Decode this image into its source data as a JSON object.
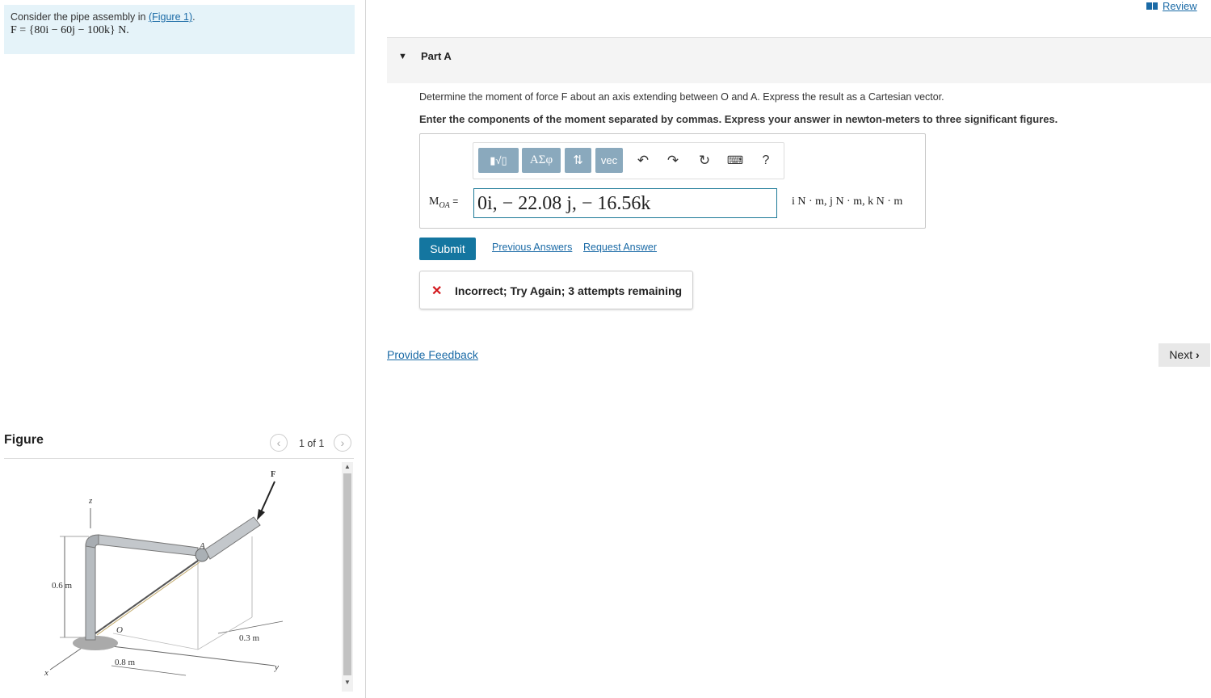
{
  "problem": {
    "intro": "Consider the pipe assembly in ",
    "figure_link": "(Figure 1)",
    "intro_end": ".",
    "force": "F = {80i − 60j − 100k} N."
  },
  "figure": {
    "title": "Figure",
    "page": "1 of 1",
    "labels": {
      "z": "z",
      "x": "x",
      "y": "y",
      "F": "F",
      "A": "A",
      "O": "O",
      "h": "0.6 m",
      "d1": "0.8 m",
      "d2": "0.3 m"
    }
  },
  "header": {
    "review": "Review"
  },
  "part": {
    "title": "Part A",
    "question": "Determine the moment of force F about an axis extending between O and A. Express the result as a Cartesian vector.",
    "instruction": "Enter the components of the moment separated by commas. Express your answer in newton-meters to three significant figures."
  },
  "toolbar": {
    "template": "▮√▯",
    "greek": "ΑΣφ",
    "arrows": "⇅",
    "vec": "vec",
    "help": "?"
  },
  "answer": {
    "label": "M",
    "label_sub": "OA",
    "equals": "=",
    "value": "0i, − 22.08 j, − 16.56k",
    "units": "i N · m, j N · m, k N · m"
  },
  "actions": {
    "submit": "Submit",
    "previous_answers": "Previous Answers",
    "request_answer": "Request Answer"
  },
  "feedback": {
    "icon": "✕",
    "message": "Incorrect; Try Again; 3 attempts remaining"
  },
  "footer": {
    "provide_feedback": "Provide Feedback",
    "next": "Next"
  },
  "colors": {
    "accent": "#1476a0",
    "problem_bg": "#e5f3f9",
    "error": "#d3171c",
    "toolbar_btn": "#8aa9bd"
  }
}
